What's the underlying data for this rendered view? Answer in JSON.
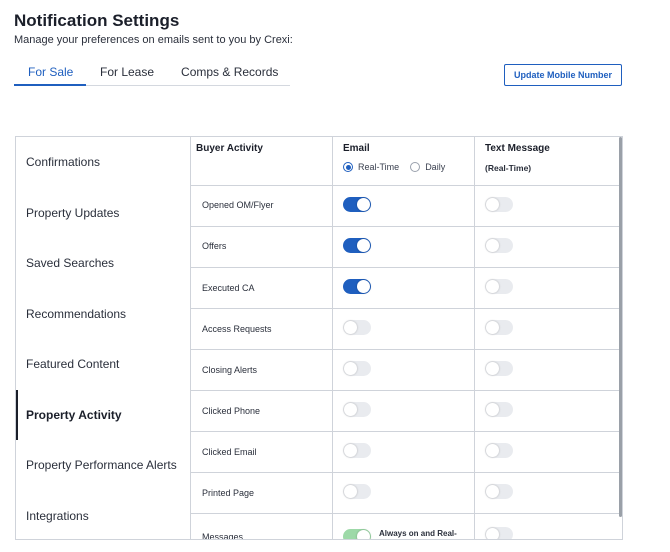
{
  "page": {
    "title": "Notification Settings",
    "subtitle": "Manage your preferences on emails sent to you by Crexi:"
  },
  "tabs": [
    {
      "label": "For Sale",
      "active": true
    },
    {
      "label": "For Lease",
      "active": false
    },
    {
      "label": "Comps & Records",
      "active": false
    }
  ],
  "update_mobile_button": "Update Mobile Number",
  "sidebar": {
    "items": [
      {
        "label": "Confirmations",
        "active": false
      },
      {
        "label": "Property Updates",
        "active": false
      },
      {
        "label": "Saved Searches",
        "active": false
      },
      {
        "label": "Recommendations",
        "active": false
      },
      {
        "label": "Featured Content",
        "active": false
      },
      {
        "label": "Property Activity",
        "active": true
      },
      {
        "label": "Property Performance Alerts",
        "active": false
      },
      {
        "label": "Integrations",
        "active": false
      }
    ]
  },
  "table": {
    "section_header": "Buyer Activity",
    "email_header": "Email",
    "text_header": "Text Message",
    "text_subheader": "(Real-Time)",
    "email_frequency": {
      "options": [
        "Real-Time",
        "Daily"
      ],
      "selected": "Real-Time"
    },
    "rows": [
      {
        "label": "Opened OM/Flyer",
        "email": true,
        "text": false
      },
      {
        "label": "Offers",
        "email": true,
        "text": false
      },
      {
        "label": "Executed CA",
        "email": true,
        "text": false
      },
      {
        "label": "Access Requests",
        "email": false,
        "text": false
      },
      {
        "label": "Closing Alerts",
        "email": false,
        "text": false
      },
      {
        "label": "Clicked Phone",
        "email": false,
        "text": false
      },
      {
        "label": "Clicked Email",
        "email": false,
        "text": false
      },
      {
        "label": "Printed Page",
        "email": false,
        "text": false
      },
      {
        "label": "Messages",
        "email": true,
        "text": false,
        "email_locked": true
      }
    ],
    "always_on_note": "Always on and Real-"
  },
  "colors": {
    "accent": "#1f5fbf",
    "toggle_off": "#e9ebef",
    "toggle_locked": "#9dd9a8",
    "border": "#cfd3da"
  }
}
